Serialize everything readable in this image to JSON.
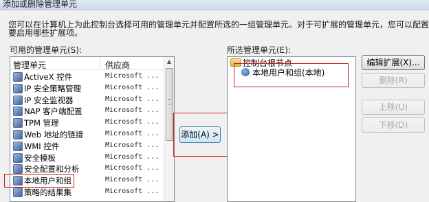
{
  "dialog": {
    "title": "添加或删除管理单元"
  },
  "description": "您可以在计算机上为此控制台选择可用的管理单元并配置所选的一组管理单元。对于可扩展的管理单元，您可以配置要启用哪些扩展项。",
  "available": {
    "label": "可用的管理单元(S):",
    "columns": {
      "name": "管理单元",
      "vendor": "供应商"
    },
    "items": [
      {
        "name": "ActiveX 控件",
        "vendor": "Microsoft ..."
      },
      {
        "name": "IP 安全策略管理",
        "vendor": "Microsoft ..."
      },
      {
        "name": "IP 安全监视器",
        "vendor": "Microsoft ..."
      },
      {
        "name": "NAP 客户端配置",
        "vendor": "Microsoft ..."
      },
      {
        "name": "TPM 管理",
        "vendor": "Microsoft ..."
      },
      {
        "name": "Web 地址的链接",
        "vendor": "Microsoft ..."
      },
      {
        "name": "WMI 控件",
        "vendor": "Microsoft ..."
      },
      {
        "name": "安全模板",
        "vendor": "Microsoft ..."
      },
      {
        "name": "安全配置和分析",
        "vendor": "Microsoft ..."
      },
      {
        "name": "本地用户和组",
        "vendor": "Microsoft ..."
      },
      {
        "name": "策略的结果集",
        "vendor": "Microsoft ..."
      }
    ]
  },
  "add_button": {
    "label": "添加(A) >"
  },
  "selected": {
    "label": "所选管理单元(E):",
    "root": "控制台根节点",
    "child": "本地用户和组(本地)"
  },
  "buttons": {
    "edit_extensions": "编辑扩展(X)...",
    "remove": "删除(R)",
    "move_up": "上移(U)",
    "move_down": "下移(D)"
  }
}
